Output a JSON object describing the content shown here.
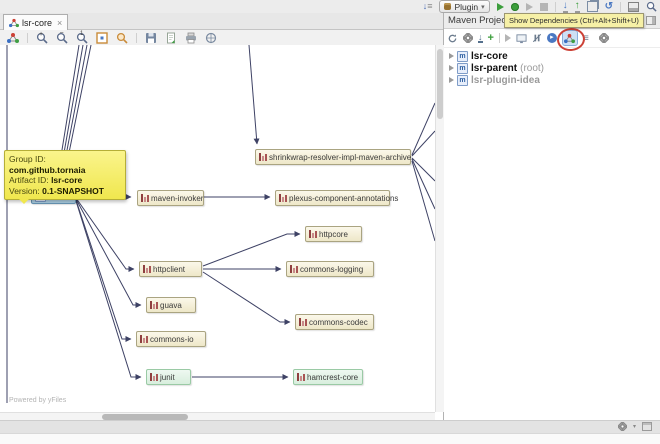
{
  "editor": {
    "tab": {
      "label": "lsr-core",
      "close": "×"
    },
    "toolbar_icons": [
      "layout-settings",
      "zoom-in",
      "zoom-out",
      "actual-size",
      "fit-content",
      "zoom-region",
      "save",
      "export-image",
      "print",
      "open-preview"
    ]
  },
  "graph": {
    "tooltip": {
      "group_label": "Group ID:",
      "group_value": "com.github.tornaia",
      "artifact_label": "Artifact ID:",
      "artifact_value": "lsr-core",
      "version_label": "Version:",
      "version_value": "0.1-SNAPSHOT"
    },
    "nodes": [
      {
        "label": "lsr-core",
        "state": "selected"
      },
      {
        "label": "shrinkwrap-resolver-impl-maven-archive",
        "state": "normal"
      },
      {
        "label": "maven-invoker",
        "state": "normal"
      },
      {
        "label": "plexus-component-annotations",
        "state": "normal"
      },
      {
        "label": "httpcore",
        "state": "normal"
      },
      {
        "label": "httpclient",
        "state": "normal"
      },
      {
        "label": "commons-logging",
        "state": "normal"
      },
      {
        "label": "guava",
        "state": "normal"
      },
      {
        "label": "commons-codec",
        "state": "normal"
      },
      {
        "label": "commons-io",
        "state": "normal"
      },
      {
        "label": "junit",
        "state": "test"
      },
      {
        "label": "hamcrest-core",
        "state": "test"
      }
    ],
    "powered_by": "Powered by yFiles"
  },
  "main_toolbar": {
    "run_config_label": "Plugin",
    "caret": "▾",
    "icons": [
      "sort",
      "run",
      "coverage",
      "profile",
      "stop",
      "vcs-update",
      "vcs-commit",
      "diff",
      "undo",
      "toolwindow",
      "search"
    ]
  },
  "maven_panel": {
    "title": "Maven Projects",
    "action_tooltip": "Show Dependencies (Ctrl+Alt+Shift+U)",
    "toolbar_icons": [
      "reimport",
      "generate-sources",
      "download-sources",
      "add-project",
      "execute-goal",
      "offline-mode",
      "skip-tests",
      "navigate",
      "show-dependencies",
      "collapse-all",
      "settings"
    ],
    "tree": [
      {
        "label": "lsr-core",
        "suffix": ""
      },
      {
        "label": "lsr-parent",
        "suffix": "(root)"
      },
      {
        "label": "lsr-plugin-idea",
        "suffix": ""
      }
    ]
  },
  "colors": {
    "edge": "#3e4265",
    "node_bg": "#f7f3da",
    "node_border": "#aaa481",
    "selected_bg": "#b7d8e9",
    "selected_border": "#6795b5",
    "test_bg": "#e3f3e8",
    "test_border": "#9acaa5",
    "graph_tooltip_bg": "#f5ec62",
    "action_tooltip_bg": "#f6f0a6",
    "annotation_red": "#cc4136"
  }
}
